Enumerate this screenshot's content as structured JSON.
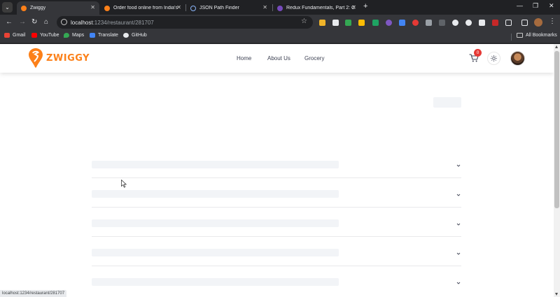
{
  "browser": {
    "tabs": [
      {
        "title": "Zwiggy",
        "active": true,
        "favicon": "swiggy-icon"
      },
      {
        "title": "Order food online from India's",
        "active": false,
        "favicon": "swiggy-icon"
      },
      {
        "title": "JSON Path Finder",
        "active": false,
        "favicon": "json-icon"
      },
      {
        "title": "Redux Fundamentals, Part 2: C",
        "active": false,
        "favicon": "redux-icon"
      }
    ],
    "omnibox": {
      "host": "localhost",
      "path": ":1234/restaurant/281707"
    },
    "bookmarks": [
      {
        "label": "Gmail",
        "icon": "gmail-icon"
      },
      {
        "label": "YouTube",
        "icon": "youtube-icon"
      },
      {
        "label": "Maps",
        "icon": "maps-icon"
      },
      {
        "label": "Translate",
        "icon": "translate-icon"
      },
      {
        "label": "GitHub",
        "icon": "github-icon"
      }
    ],
    "all_bookmarks": "All Bookmarks",
    "status_url": "localhost:1234/restaurant/281707"
  },
  "site": {
    "brand": "ZWIGGY",
    "brand_color": "#fc8019",
    "nav": [
      "Home",
      "About Us",
      "Grocery"
    ],
    "cart_count": "0"
  },
  "colors": {
    "shimmer": "#f2f4f7",
    "badge": "#e53935"
  }
}
